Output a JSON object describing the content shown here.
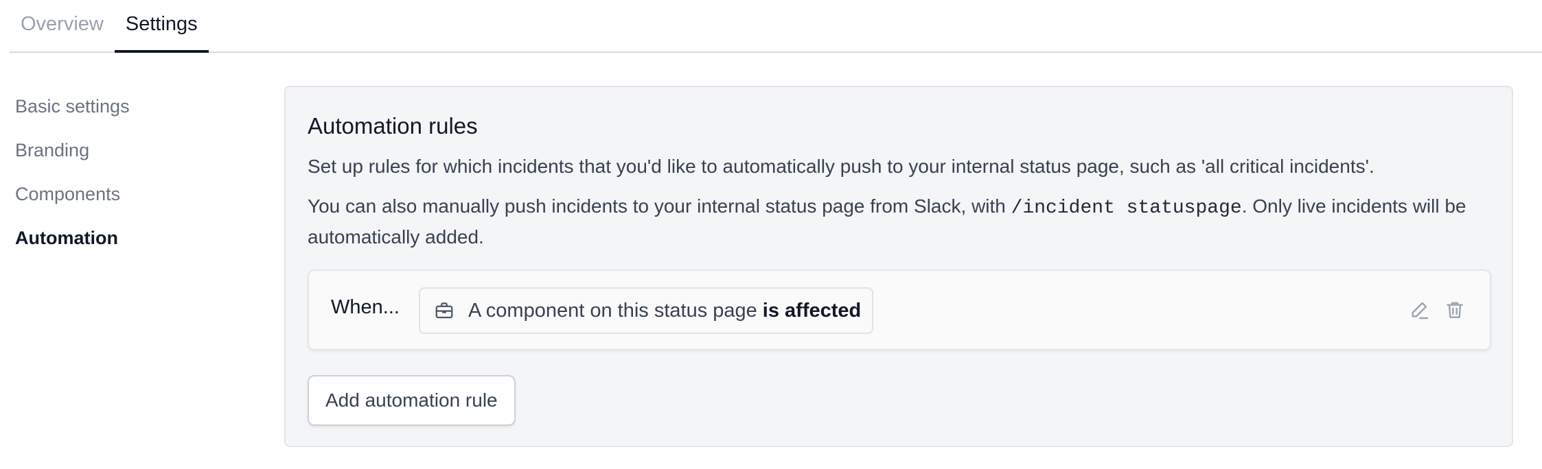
{
  "tabs": [
    {
      "label": "Overview",
      "active": false
    },
    {
      "label": "Settings",
      "active": true
    }
  ],
  "sidebar": {
    "items": [
      {
        "label": "Basic settings"
      },
      {
        "label": "Branding"
      },
      {
        "label": "Components"
      },
      {
        "label": "Automation"
      }
    ],
    "active_item": "Automation"
  },
  "automation": {
    "title": "Automation rules",
    "description1": "Set up rules for which incidents that you'd like to automatically push to your internal status page, such as 'all critical incidents'.",
    "description2_prefix": "You can also manually push incidents to your internal status page from Slack, with ",
    "description2_code": "/incident statuspage",
    "description2_suffix": ". Only live incidents will be automatically added.",
    "rule": {
      "when_label": "When...",
      "condition_text": "A component on this status page",
      "condition_bold": "is affected",
      "condition_icon": "briefcase-icon",
      "actions": [
        "edit-icon",
        "trash-icon"
      ]
    },
    "add_button_label": "Add automation rule"
  },
  "colors": {
    "text_primary": "#111827",
    "text_secondary": "#6b7280",
    "panel_bg": "#f4f5f7",
    "border": "#e3e5e9"
  }
}
